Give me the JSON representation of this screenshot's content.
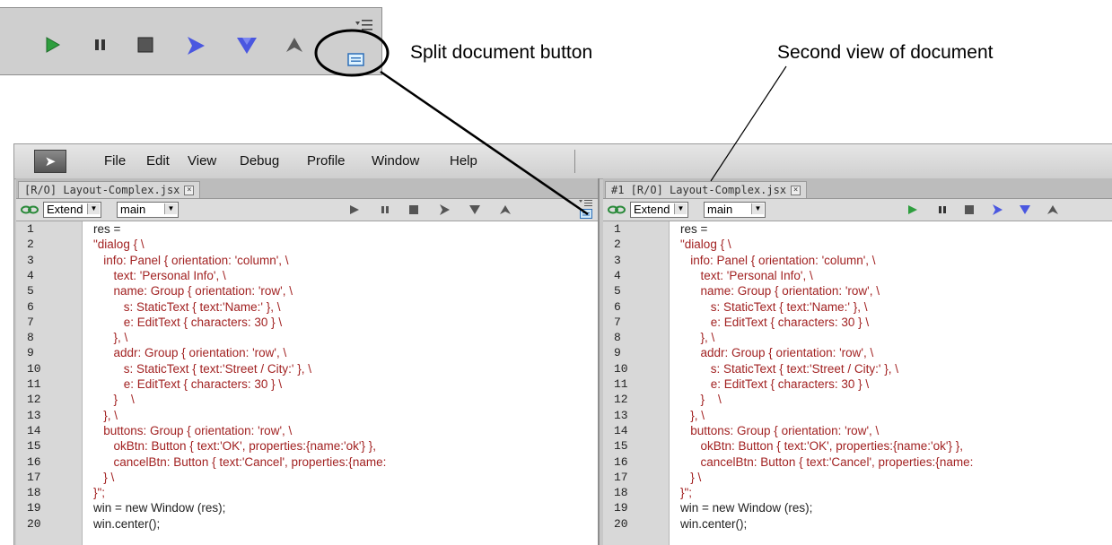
{
  "callouts": {
    "split_label": "Split document button",
    "second_label": "Second view of document"
  },
  "menu": [
    "File",
    "Edit",
    "View",
    "Debug",
    "Profile",
    "Window",
    "Help"
  ],
  "left_pane": {
    "tab_title": "[R/O] Layout-Complex.jsx",
    "target_select": "Extend",
    "engine_select": "main"
  },
  "right_pane": {
    "tab_title": "#1 [R/O] Layout-Complex.jsx",
    "target_select": "Extend",
    "engine_select": "main"
  },
  "toolbar_icons": [
    "run-icon",
    "pause-icon",
    "stop-icon",
    "step-over-icon",
    "step-into-icon",
    "step-out-icon",
    "panel-options-icon",
    "split-document-icon"
  ],
  "colors": {
    "code_text": "#a22222",
    "run_green": "#2e9e3e",
    "step_blue": "#4a57e0",
    "step_into_blue": "#4a57e0"
  },
  "code_lines": [
    {
      "n": "1",
      "text": "res ="
    },
    {
      "n": "2",
      "text": "\"dialog { \\"
    },
    {
      "n": "3",
      "text": "   info: Panel { orientation: 'column', \\"
    },
    {
      "n": "4",
      "text": "      text: 'Personal Info', \\"
    },
    {
      "n": "5",
      "text": "      name: Group { orientation: 'row', \\"
    },
    {
      "n": "6",
      "text": "         s: StaticText { text:'Name:' }, \\"
    },
    {
      "n": "7",
      "text": "         e: EditText { characters: 30 } \\"
    },
    {
      "n": "8",
      "text": "      }, \\"
    },
    {
      "n": "9",
      "text": "      addr: Group { orientation: 'row', \\"
    },
    {
      "n": "10",
      "text": "         s: StaticText { text:'Street / City:' }, \\"
    },
    {
      "n": "11",
      "text": "         e: EditText { characters: 30 } \\"
    },
    {
      "n": "12",
      "text": "      }    \\"
    },
    {
      "n": "13",
      "text": "   }, \\"
    },
    {
      "n": "14",
      "text": "   buttons: Group { orientation: 'row', \\"
    },
    {
      "n": "15",
      "text": "      okBtn: Button { text:'OK', properties:{name:'ok'} },"
    },
    {
      "n": "16",
      "text": "      cancelBtn: Button { text:'Cancel', properties:{name:"
    },
    {
      "n": "17",
      "text": "   } \\"
    },
    {
      "n": "18",
      "text": "}\";"
    },
    {
      "n": "19",
      "text": "win = new Window (res);"
    },
    {
      "n": "20",
      "text": "win.center();"
    }
  ]
}
